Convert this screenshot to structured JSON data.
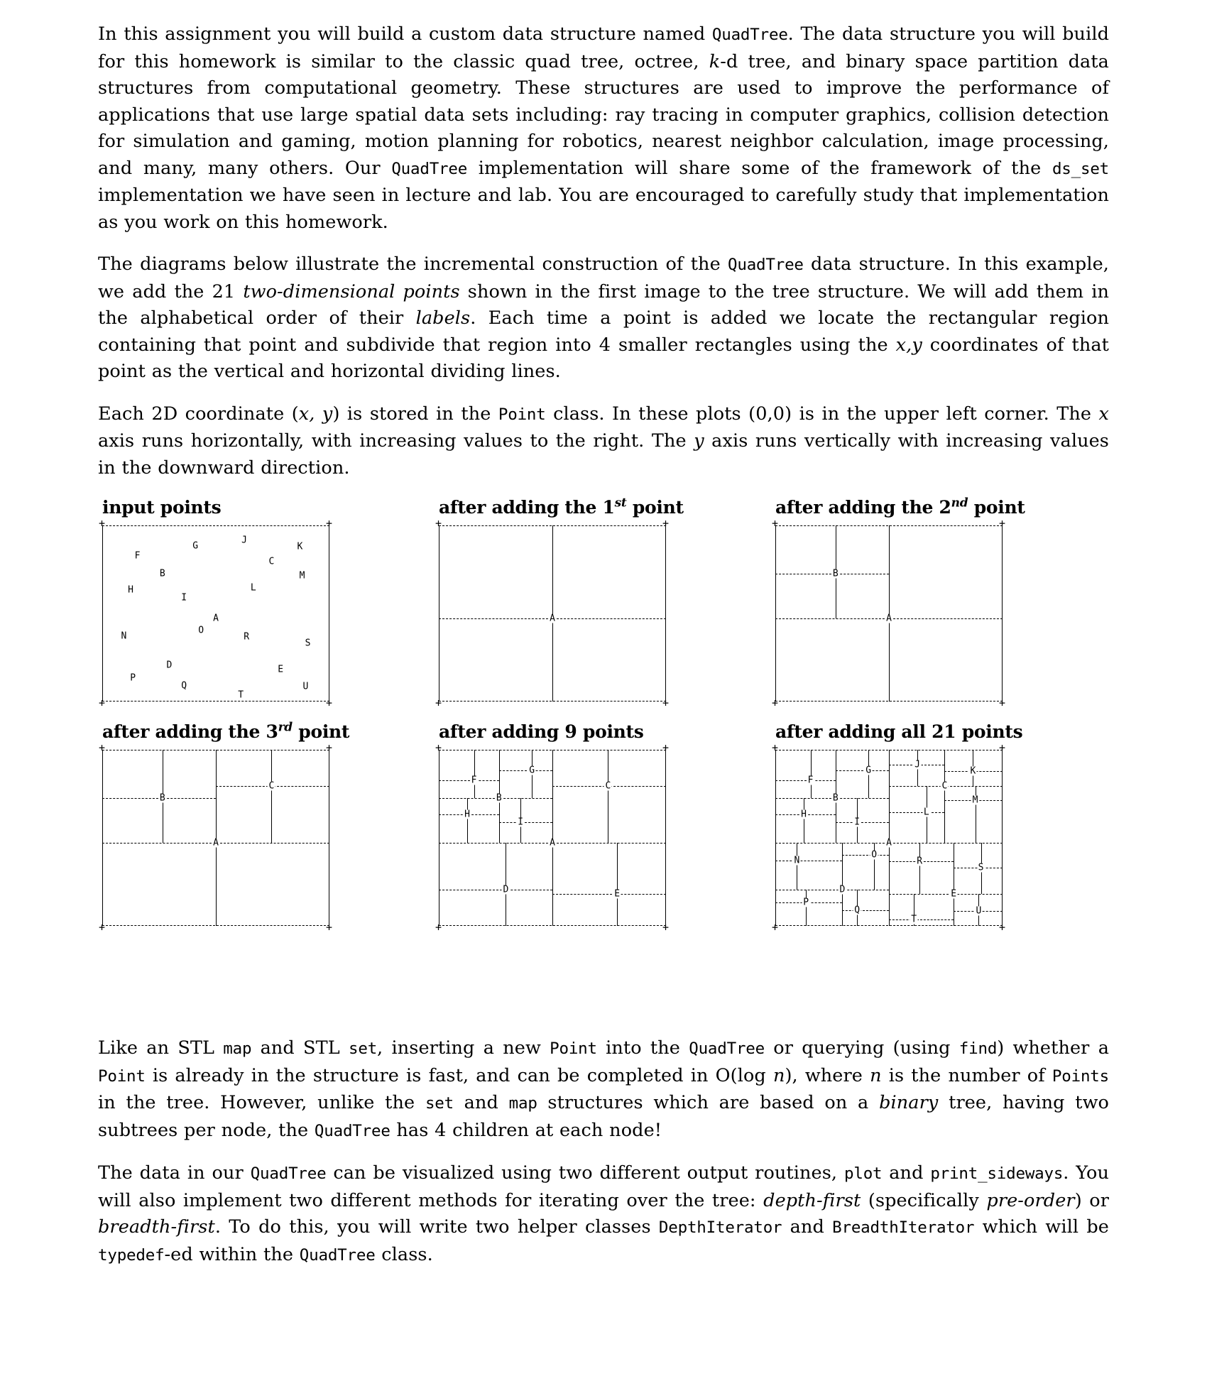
{
  "document": {
    "paragraphs": [
      {
        "id": "intro",
        "runs": [
          {
            "t": "In this assignment you will build a custom data structure named ",
            "s": "n"
          },
          {
            "t": "QuadTree",
            "s": "tt"
          },
          {
            "t": ". The data structure you will build for this homework is similar to the classic quad tree, octree, ",
            "s": "n"
          },
          {
            "t": "k",
            "s": "mathit"
          },
          {
            "t": "-d tree, and binary space partition data structures from computational geometry. These structures are used to improve the performance of applications that use large spatial data sets including: ray tracing in computer graphics, collision detection for simulation and gaming, motion planning for robotics, nearest neighbor calculation, image processing, and many, many others. Our ",
            "s": "n"
          },
          {
            "t": "QuadTree",
            "s": "tt"
          },
          {
            "t": " implementation will share some of the framework of the ",
            "s": "n"
          },
          {
            "t": "ds_set",
            "s": "tt"
          },
          {
            "t": " implementation we have seen in lecture and lab. You are encouraged to carefully study that implementation as you work on this homework.",
            "s": "n"
          }
        ]
      },
      {
        "id": "diagrams-intro",
        "runs": [
          {
            "t": "The diagrams below illustrate the incremental construction of the ",
            "s": "n"
          },
          {
            "t": "QuadTree",
            "s": "tt"
          },
          {
            "t": " data structure. In this example, we add the 21 ",
            "s": "n"
          },
          {
            "t": "two-dimensional points",
            "s": "it"
          },
          {
            "t": " shown in the first image to the tree structure. We will add them in the alphabetical order of their ",
            "s": "n"
          },
          {
            "t": "labels",
            "s": "it"
          },
          {
            "t": ". Each time a point is added we locate the rectangular region containing that point and subdivide that region into 4 smaller rectangles using the ",
            "s": "n"
          },
          {
            "t": "x,y",
            "s": "mathit"
          },
          {
            "t": " coordinates of that point as the vertical and horizontal dividing lines.",
            "s": "n"
          }
        ]
      },
      {
        "id": "coordinates",
        "runs": [
          {
            "t": "Each 2D coordinate (",
            "s": "n"
          },
          {
            "t": "x, y",
            "s": "mathit"
          },
          {
            "t": ") is stored in the ",
            "s": "n"
          },
          {
            "t": "Point",
            "s": "tt"
          },
          {
            "t": " class. In these plots (0,0) is in the upper left corner. The ",
            "s": "n"
          },
          {
            "t": "x",
            "s": "mathit"
          },
          {
            "t": " axis runs horizontally, with increasing values to the right. The ",
            "s": "n"
          },
          {
            "t": "y",
            "s": "mathit"
          },
          {
            "t": " axis runs vertically with increasing values in the downward direction.",
            "s": "n"
          }
        ]
      },
      {
        "id": "stl-comparison",
        "runs": [
          {
            "t": "Like an STL ",
            "s": "n"
          },
          {
            "t": "map",
            "s": "tt"
          },
          {
            "t": " and STL ",
            "s": "n"
          },
          {
            "t": "set",
            "s": "tt"
          },
          {
            "t": ", inserting a new ",
            "s": "n"
          },
          {
            "t": "Point",
            "s": "tt"
          },
          {
            "t": " into the ",
            "s": "n"
          },
          {
            "t": "QuadTree",
            "s": "tt"
          },
          {
            "t": " or querying (using ",
            "s": "n"
          },
          {
            "t": "find",
            "s": "tt"
          },
          {
            "t": ") whether a ",
            "s": "n"
          },
          {
            "t": "Point",
            "s": "tt"
          },
          {
            "t": " is already in the structure is fast, and can be completed in O(log ",
            "s": "n"
          },
          {
            "t": "n",
            "s": "mathit"
          },
          {
            "t": "), where ",
            "s": "n"
          },
          {
            "t": "n",
            "s": "mathit"
          },
          {
            "t": " is the number of ",
            "s": "n"
          },
          {
            "t": "Points",
            "s": "tt"
          },
          {
            "t": " in the tree. However, unlike the ",
            "s": "n"
          },
          {
            "t": "set",
            "s": "tt"
          },
          {
            "t": " and ",
            "s": "n"
          },
          {
            "t": "map",
            "s": "tt"
          },
          {
            "t": " structures which are based on a ",
            "s": "n"
          },
          {
            "t": "binary",
            "s": "it"
          },
          {
            "t": " tree, having two subtrees per node, the ",
            "s": "n"
          },
          {
            "t": "QuadTree",
            "s": "tt"
          },
          {
            "t": " has 4 children at each node!",
            "s": "n"
          }
        ]
      },
      {
        "id": "visualization",
        "runs": [
          {
            "t": "The data in our ",
            "s": "n"
          },
          {
            "t": "QuadTree",
            "s": "tt"
          },
          {
            "t": " can be visualized using two different output routines, ",
            "s": "n"
          },
          {
            "t": "plot",
            "s": "tt"
          },
          {
            "t": " and ",
            "s": "n"
          },
          {
            "t": "print_sideways",
            "s": "tt"
          },
          {
            "t": ". You will also implement two different methods for iterating over the tree: ",
            "s": "n"
          },
          {
            "t": "depth-first",
            "s": "it"
          },
          {
            "t": " (specifically ",
            "s": "n"
          },
          {
            "t": "pre-order",
            "s": "it"
          },
          {
            "t": ") or ",
            "s": "n"
          },
          {
            "t": "breadth-first",
            "s": "it"
          },
          {
            "t": ". To do this, you will write two helper classes ",
            "s": "n"
          },
          {
            "t": "DepthIterator",
            "s": "tt"
          },
          {
            "t": " and ",
            "s": "n"
          },
          {
            "t": "BreadthIterator",
            "s": "tt"
          },
          {
            "t": " which will be ",
            "s": "n"
          },
          {
            "t": "typedef",
            "s": "tt"
          },
          {
            "t": "-ed within the ",
            "s": "n"
          },
          {
            "t": "QuadTree",
            "s": "tt"
          },
          {
            "t": " class.",
            "s": "n"
          }
        ]
      }
    ]
  },
  "figures": {
    "captions": {
      "input_points": "input points",
      "first_point": {
        "pre": "after adding the 1",
        "ord": "st",
        "post": " point"
      },
      "second_point": {
        "pre": "after adding the 2",
        "ord": "nd",
        "post": " point"
      },
      "third_point": {
        "pre": "after adding the 3",
        "ord": "rd",
        "post": " point"
      },
      "nine_points": "after adding 9 points",
      "all_points": "after adding all 21 points"
    },
    "corner_glyph": "+",
    "labels": {
      "A": "A",
      "B": "B",
      "C": "C",
      "D": "D",
      "E": "E",
      "F": "F",
      "G": "G",
      "H": "H",
      "I": "I",
      "J": "J",
      "K": "K",
      "L": "L",
      "M": "M",
      "N": "N",
      "O": "O",
      "P": "P",
      "Q": "Q",
      "R": "R",
      "S": "S",
      "T": "T",
      "U": "U"
    }
  },
  "chart_data": {
    "type": "scatter",
    "title": "input points",
    "xlabel": "x (increasing to the right)",
    "ylabel": "y (increasing downward)",
    "xlim": [
      0,
      100
    ],
    "ylim": [
      0,
      100
    ],
    "origin": "upper-left",
    "n_points": 21,
    "insertion_order": [
      "A",
      "B",
      "C",
      "D",
      "E",
      "F",
      "G",
      "H",
      "I",
      "J",
      "K",
      "L",
      "M",
      "N",
      "O",
      "P",
      "Q",
      "R",
      "S",
      "T",
      "U"
    ],
    "points": [
      {
        "label": "A",
        "x": 50.0,
        "y": 53.0
      },
      {
        "label": "B",
        "x": 26.5,
        "y": 27.5
      },
      {
        "label": "C",
        "x": 74.5,
        "y": 20.5
      },
      {
        "label": "D",
        "x": 29.5,
        "y": 79.5
      },
      {
        "label": "E",
        "x": 78.5,
        "y": 82.0
      },
      {
        "label": "F",
        "x": 15.5,
        "y": 17.5
      },
      {
        "label": "G",
        "x": 41.0,
        "y": 11.5
      },
      {
        "label": "H",
        "x": 12.5,
        "y": 36.5
      },
      {
        "label": "I",
        "x": 36.0,
        "y": 41.0
      },
      {
        "label": "J",
        "x": 62.5,
        "y": 8.5
      },
      {
        "label": "K",
        "x": 87.0,
        "y": 12.0
      },
      {
        "label": "L",
        "x": 66.5,
        "y": 35.5
      },
      {
        "label": "M",
        "x": 88.0,
        "y": 28.5
      },
      {
        "label": "N",
        "x": 9.5,
        "y": 63.0
      },
      {
        "label": "O",
        "x": 43.5,
        "y": 59.5
      },
      {
        "label": "P",
        "x": 13.5,
        "y": 86.5
      },
      {
        "label": "Q",
        "x": 36.0,
        "y": 91.0
      },
      {
        "label": "R",
        "x": 63.5,
        "y": 63.5
      },
      {
        "label": "S",
        "x": 90.5,
        "y": 67.0
      },
      {
        "label": "T",
        "x": 61.0,
        "y": 96.5
      },
      {
        "label": "U",
        "x": 89.5,
        "y": 91.5
      }
    ],
    "stages": [
      {
        "name": "after adding the 1st point",
        "nodes": [
          "A"
        ]
      },
      {
        "name": "after adding the 2nd point",
        "nodes": [
          "A",
          "B"
        ]
      },
      {
        "name": "after adding the 3rd point",
        "nodes": [
          "A",
          "B",
          "C"
        ]
      },
      {
        "name": "after adding 9 points",
        "nodes": [
          "A",
          "B",
          "C",
          "D",
          "E",
          "F",
          "G",
          "H",
          "I"
        ]
      },
      {
        "name": "after adding all 21 points",
        "nodes": [
          "A",
          "B",
          "C",
          "D",
          "E",
          "F",
          "G",
          "H",
          "I",
          "J",
          "K",
          "L",
          "M",
          "N",
          "O",
          "P",
          "Q",
          "R",
          "S",
          "T",
          "U"
        ]
      }
    ]
  }
}
